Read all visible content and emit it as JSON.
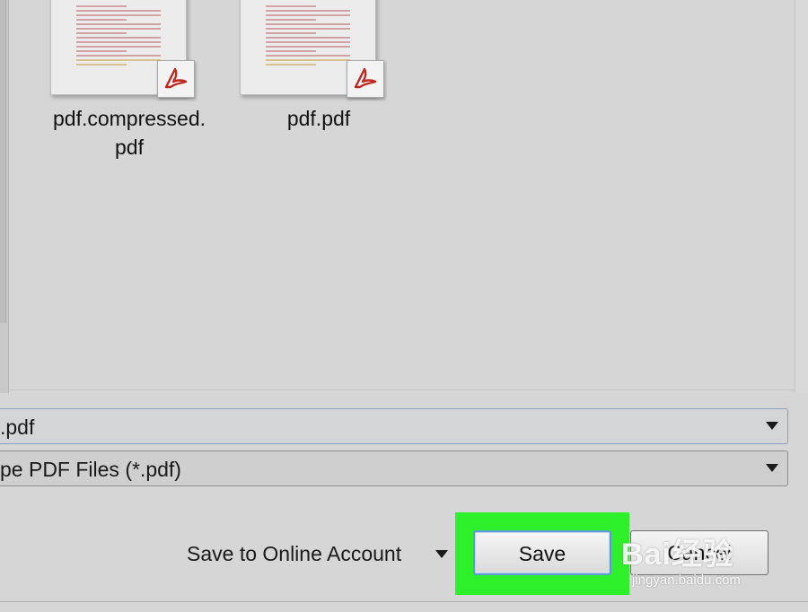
{
  "files": [
    {
      "name": "pdf.compressed.\npdf",
      "line1": "pdf.compressed.",
      "line2": "pdf",
      "icon": "pdf-icon"
    },
    {
      "name": "pdf.pdf",
      "line1": "pdf.pdf",
      "line2": "",
      "icon": "pdf-icon"
    }
  ],
  "filename_field": {
    "value": ".pdf"
  },
  "filetype_field": {
    "value": "pe PDF Files (*.pdf)"
  },
  "online_account": {
    "label": "Save to Online Account"
  },
  "buttons": {
    "save": "Save",
    "cancel": "Cancel"
  },
  "watermark": {
    "brand": "Bai经验",
    "url": "jingyan.baidu.com"
  },
  "colors": {
    "highlight": "#2ef02a",
    "pdf_red": "#c0271f"
  }
}
